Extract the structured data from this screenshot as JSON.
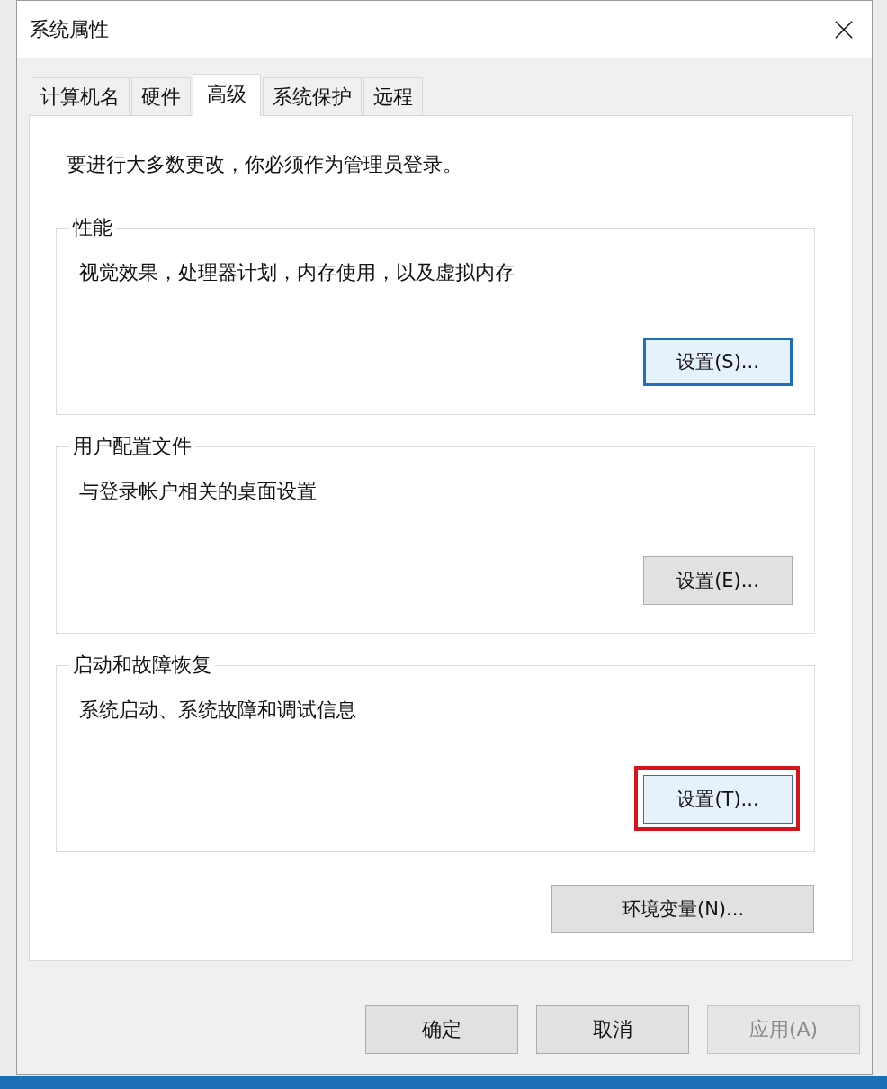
{
  "window": {
    "title": "系统属性"
  },
  "tabs": [
    {
      "label": "计算机名",
      "selected": false
    },
    {
      "label": "硬件",
      "selected": false
    },
    {
      "label": "高级",
      "selected": true
    },
    {
      "label": "系统保护",
      "selected": false
    },
    {
      "label": "远程",
      "selected": false
    }
  ],
  "notice": "要进行大多数更改，你必须作为管理员登录。",
  "groups": [
    {
      "title": "性能",
      "description": "视觉效果，处理器计划，内存使用，以及虚拟内存",
      "button": {
        "label": "设置(S)...",
        "default": true,
        "highlighted": false
      }
    },
    {
      "title": "用户配置文件",
      "description": "与登录帐户相关的桌面设置",
      "button": {
        "label": "设置(E)...",
        "default": false,
        "highlighted": false
      }
    },
    {
      "title": "启动和故障恢复",
      "description": "系统启动、系统故障和调试信息",
      "button": {
        "label": "设置(T)...",
        "default": false,
        "highlighted": true
      }
    }
  ],
  "extra_button": {
    "label": "环境变量(N)..."
  },
  "footer_buttons": [
    {
      "label": "确定",
      "disabled": false
    },
    {
      "label": "取消",
      "disabled": false
    },
    {
      "label": "应用(A)",
      "disabled": true
    }
  ]
}
